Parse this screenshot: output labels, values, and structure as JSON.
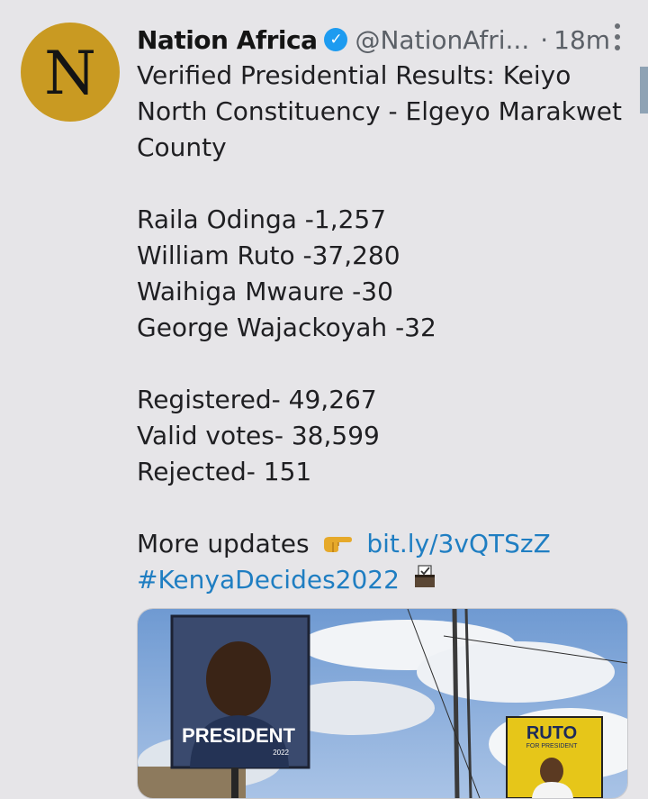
{
  "tweet": {
    "avatar_letter": "N",
    "display_name": "Nation Africa",
    "handle": "@NationAfri...",
    "time_ago": "18m",
    "lines": [
      "Verified Presidential Results: Keiyo",
      "North Constituency - Elgeyo Marakwet",
      "County",
      "",
      "Raila Odinga -1,257",
      "William Ruto -37,280",
      "Waihiga Mwaure -30",
      "George Wajackoyah -32",
      "",
      "Registered- 49,267",
      "Valid votes- 38,599",
      "Rejected- 151",
      ""
    ],
    "more_updates": "More updates",
    "link": "bit.ly/3vQTSzZ",
    "hashtag": "#KenyaDecides2022"
  },
  "image": {
    "billboard_left": "PRESIDENT",
    "billboard_left_year": "2022",
    "billboard_right": "RUTO",
    "billboard_right_sub": "FOR PRESIDENT"
  },
  "colors": {
    "link": "#1f7ec2",
    "verified": "#1d9bf0",
    "avatar": "#c99a22"
  },
  "icons": [
    "verified-badge-icon",
    "more-options-icon",
    "pointing-hand-icon",
    "ballot-box-icon"
  ]
}
